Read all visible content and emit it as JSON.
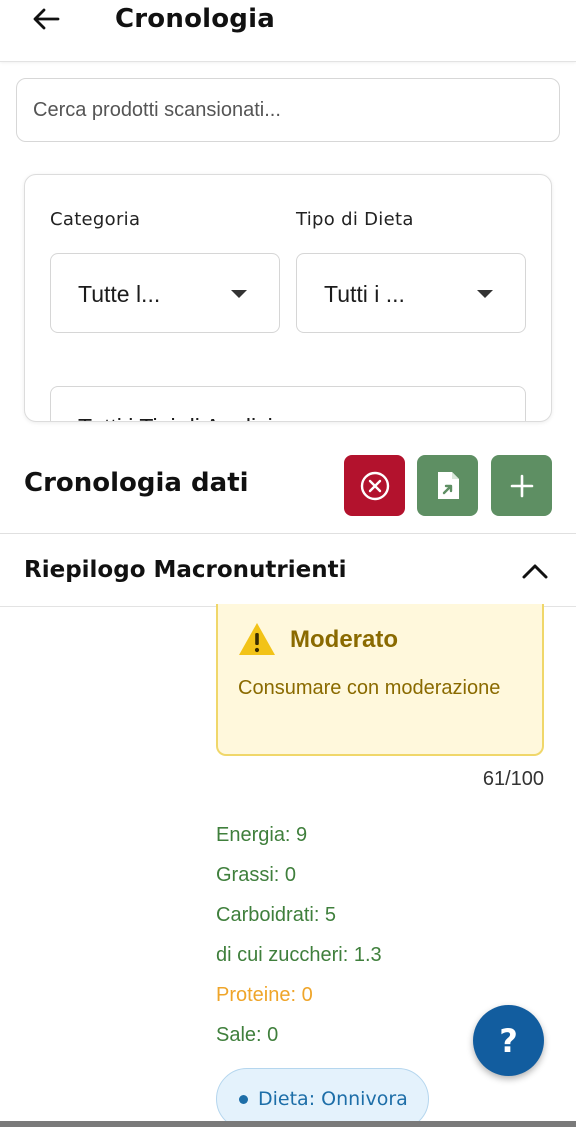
{
  "header": {
    "title": "Cronologia",
    "back_icon": "arrow-left-icon"
  },
  "search": {
    "placeholder": "Cerca prodotti scansionati..."
  },
  "filters": {
    "category_label": "Categoria",
    "category_value": "Tutte l...",
    "diet_label": "Tipo di Dieta",
    "diet_value": "Tutti i ...",
    "analysis_value": "Tutti i Tipi di Analisi"
  },
  "history": {
    "title": "Cronologia dati",
    "clear_icon": "close-circle-icon",
    "export_icon": "file-export-icon",
    "add_icon": "plus-icon"
  },
  "macro_summary": {
    "title": "Riepilogo Macronutrienti",
    "chevron_icon": "chevron-up-icon"
  },
  "warning": {
    "icon": "warning-triangle-icon",
    "title": "Moderato",
    "text": "Consumare con moderazione",
    "score": "61/100"
  },
  "nutrients": {
    "energy": "Energia: 9",
    "fat": "Grassi: 0",
    "carbs": "Carboidrati: 5",
    "sugars": "di cui zuccheri: 1.3",
    "protein": "Proteine: 0",
    "salt": "Sale: 0"
  },
  "diet_chip": {
    "label": "Dieta: Onnivora"
  },
  "help": {
    "label": "?"
  },
  "colors": {
    "danger": "#b3122d",
    "primary_green": "#5e8f63",
    "help_blue": "#125d9f",
    "warning_text": "#8a6a00",
    "nutrient_green": "#3f7f3c",
    "nutrient_orange": "#efa52a"
  }
}
